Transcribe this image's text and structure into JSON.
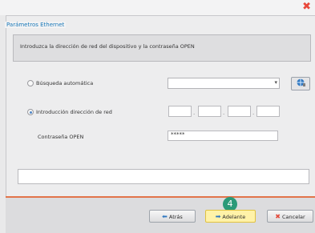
{
  "window": {
    "close_icon": "close-icon",
    "accent": "#e8473a"
  },
  "section": {
    "legend": "Parámetros Ethernet",
    "accent": "#1a78b8"
  },
  "intro": {
    "text": "Introduzca la dirección de red del dispositivo y la contraseña OPEN"
  },
  "options": {
    "auto_search": {
      "label": "Búsqueda automática",
      "selected": false,
      "dropdown_value": "",
      "button_icon": "network-search-icon"
    },
    "manual_address": {
      "label": "Introducción dirección de red",
      "selected": true,
      "ip_segments": [
        "",
        "",
        "",
        ""
      ],
      "separator": "."
    }
  },
  "password": {
    "label": "Contraseña OPEN",
    "value": "*****"
  },
  "status": {
    "text": ""
  },
  "footer": {
    "back_label": "Atrás",
    "next_label": "Adelante",
    "cancel_label": "Cancelar",
    "step_badge": "4",
    "badge_color": "#2b9a78",
    "footer_accent": "#e2744a"
  }
}
